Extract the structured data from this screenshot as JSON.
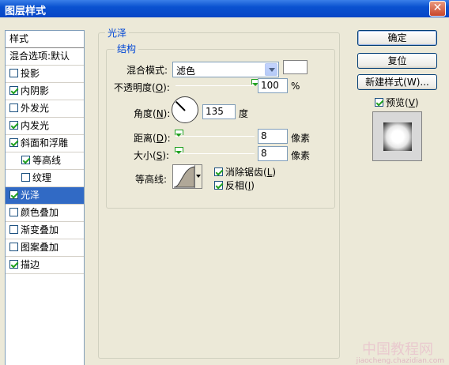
{
  "window": {
    "title": "图层样式",
    "close_glyph": "✕"
  },
  "styles_list": {
    "header": "样式",
    "blend_options": "混合选项:默认",
    "items": [
      {
        "label": "投影",
        "checked": false,
        "sub": false,
        "selected": false
      },
      {
        "label": "内阴影",
        "checked": true,
        "sub": false,
        "selected": false
      },
      {
        "label": "外发光",
        "checked": false,
        "sub": false,
        "selected": false
      },
      {
        "label": "内发光",
        "checked": true,
        "sub": false,
        "selected": false
      },
      {
        "label": "斜面和浮雕",
        "checked": true,
        "sub": false,
        "selected": false
      },
      {
        "label": "等高线",
        "checked": true,
        "sub": true,
        "selected": false
      },
      {
        "label": "纹理",
        "checked": false,
        "sub": true,
        "selected": false
      },
      {
        "label": "光泽",
        "checked": true,
        "sub": false,
        "selected": true
      },
      {
        "label": "颜色叠加",
        "checked": false,
        "sub": false,
        "selected": false
      },
      {
        "label": "渐变叠加",
        "checked": false,
        "sub": false,
        "selected": false
      },
      {
        "label": "图案叠加",
        "checked": false,
        "sub": false,
        "selected": false
      },
      {
        "label": "描边",
        "checked": true,
        "sub": false,
        "selected": false
      }
    ]
  },
  "satin": {
    "group_title": "光泽",
    "structure_title": "结构",
    "blend_mode_label": "混合模式:",
    "blend_mode_value": "滤色",
    "opacity_label_pre": "不透明度(",
    "opacity_label_key": "O",
    "opacity_label_post": "):",
    "opacity_value": "100",
    "opacity_unit": "%",
    "angle_label_pre": "角度(",
    "angle_label_key": "N",
    "angle_label_post": "):",
    "angle_value": "135",
    "angle_unit": "度",
    "distance_label_pre": "距离(",
    "distance_label_key": "D",
    "distance_label_post": "):",
    "distance_value": "8",
    "distance_unit": "像素",
    "size_label_pre": "大小(",
    "size_label_key": "S",
    "size_label_post": "):",
    "size_value": "8",
    "size_unit": "像素",
    "contour_label": "等高线:",
    "antialias_pre": "消除锯齿(",
    "antialias_key": "L",
    "antialias_post": ")",
    "antialias_checked": true,
    "invert_pre": "反相(",
    "invert_key": "I",
    "invert_post": ")",
    "invert_checked": true,
    "opacity_level": 1.0,
    "distance_level": 0.03,
    "size_level": 0.03
  },
  "buttons": {
    "ok": "确定",
    "reset": "复位",
    "new_style": "新建样式(W)...",
    "preview_pre": "预览(",
    "preview_key": "V",
    "preview_post": ")",
    "preview_checked": true
  },
  "watermark": {
    "line1": "中国教程网",
    "line2": "jiaocheng.chazidian.com"
  },
  "colors": {
    "accent": "#316ac5",
    "group_title": "#0046d5",
    "title_bar": "#0a52d0"
  }
}
